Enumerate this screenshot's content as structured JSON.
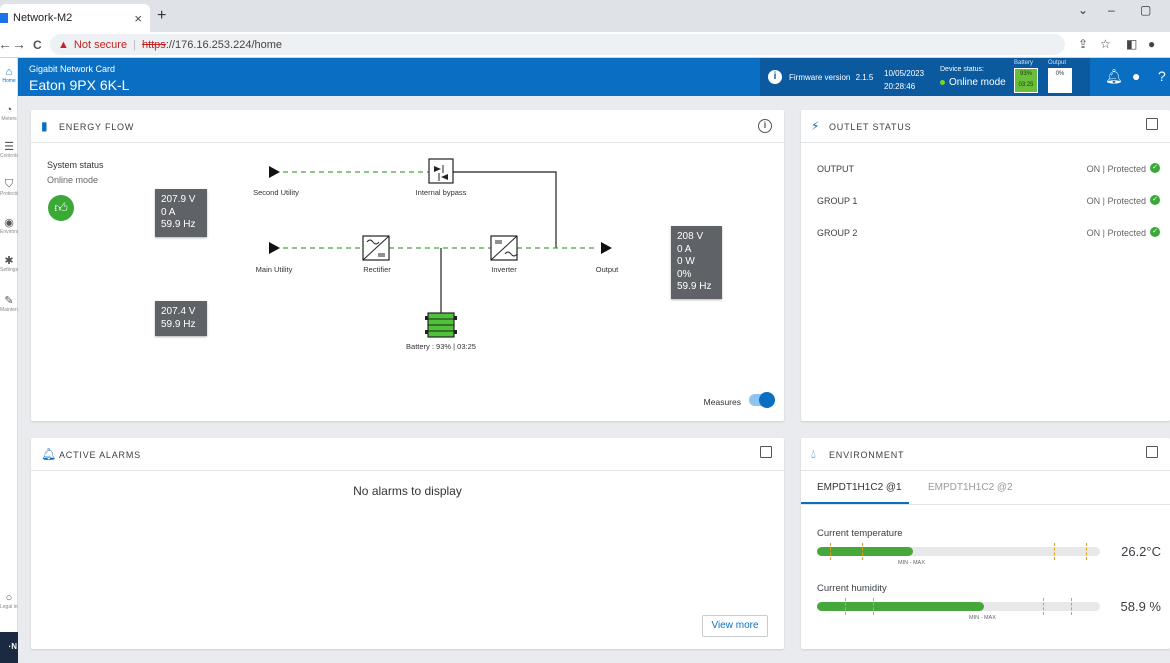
{
  "browser": {
    "tab_title": "Network-M2",
    "tab_close": "×",
    "new_tab": "+",
    "controls": {
      "chevron": "⌄",
      "minimize": "–",
      "maximize": "▢"
    },
    "back": "←",
    "forward": "→",
    "reload": "C",
    "security_label": "Not secure",
    "url_scheme": "https",
    "url_rest": "://176.16.253.224/home"
  },
  "header": {
    "subtitle": "Gigabit Network Card",
    "device_name": "Eaton 9PX 6K-L",
    "firmware_label": "Firmware version",
    "firmware_version": "2.1.5",
    "date": "10/05/2023",
    "time": "20:28:46",
    "device_status_label": "Device status:",
    "device_status": "Online mode",
    "battery_label": "Battery",
    "battery_percent": "93%",
    "battery_time": "03:25",
    "output_label": "Output",
    "output_percent": "0%"
  },
  "sidebar": {
    "items": [
      {
        "label": "Home",
        "icon": "home-icon"
      },
      {
        "label": "Meters",
        "icon": "meters-icon"
      },
      {
        "label": "Controls",
        "icon": "controls-icon"
      },
      {
        "label": "Protection",
        "icon": "protection-icon"
      },
      {
        "label": "Environment",
        "icon": "environment-icon"
      },
      {
        "label": "Settings",
        "icon": "settings-icon"
      },
      {
        "label": "Maintenance",
        "icon": "maintenance-icon"
      }
    ],
    "legal_label": "Legal info",
    "logo_text": "·N"
  },
  "energy_flow": {
    "title": "ENERGY FLOW",
    "system_status_label": "System status",
    "system_status": "Online mode",
    "second_utility": "Second Utility",
    "internal_bypass": "Internal bypass",
    "main_utility": "Main Utility",
    "rectifier": "Rectifier",
    "inverter": "Inverter",
    "output": "Output",
    "battery_label": "Battery : 93% | 03:25",
    "main_meas": [
      "207.9 V",
      "0 A",
      "59.9 Hz"
    ],
    "second_meas": [
      "207.4 V",
      "59.9 Hz"
    ],
    "output_meas": [
      "208 V",
      "0 A",
      "0 W",
      "0%",
      "59.9 Hz"
    ],
    "measures_label": "Measures",
    "measures_on": true
  },
  "outlet_status": {
    "title": "OUTLET STATUS",
    "rows": [
      {
        "name": "OUTPUT",
        "status": "ON | Protected"
      },
      {
        "name": "GROUP 1",
        "status": "ON | Protected"
      },
      {
        "name": "GROUP 2",
        "status": "ON | Protected"
      }
    ]
  },
  "active_alarms": {
    "title": "ACTIVE ALARMS",
    "empty_text": "No alarms to display",
    "view_more": "View more"
  },
  "environment": {
    "title": "ENVIRONMENT",
    "tabs": [
      "EMPDT1H1C2 @1",
      "EMPDT1H1C2 @2"
    ],
    "active_tab": 0,
    "temperature": {
      "label": "Current temperature",
      "value": "26.2°C",
      "fill": 0.34,
      "min_max_label": "MIN - MAX"
    },
    "humidity": {
      "label": "Current humidity",
      "value": "58.9 %",
      "fill": 0.59,
      "min_max_label": "MIN - MAX"
    }
  },
  "colors": {
    "brand_blue": "#0a6fc2",
    "ok_green": "#3aa935",
    "flow_green": "#46a83a",
    "danger_red": "#c5221f"
  }
}
